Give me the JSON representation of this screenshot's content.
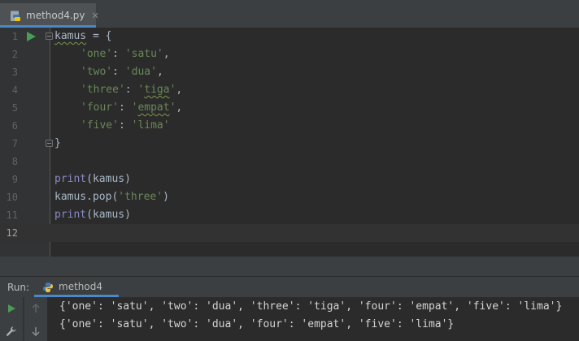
{
  "tab": {
    "filename": "method4.py",
    "close": "✕"
  },
  "editor": {
    "line_numbers": [
      "1",
      "2",
      "3",
      "4",
      "5",
      "6",
      "7",
      "8",
      "9",
      "10",
      "11",
      "12"
    ],
    "code": {
      "l1_var": "kamus",
      "l1_op": " = {",
      "l2_key": "'one'",
      "l2_sep": ": ",
      "l2_val": "'satu'",
      "l2_end": ",",
      "l3_key": "'two'",
      "l3_sep": ": ",
      "l3_val": "'dua'",
      "l3_end": ",",
      "l4_key": "'three'",
      "l4_sep": ": ",
      "l4_val_q1": "'",
      "l4_val_w": "tiga",
      "l4_val_q2": "'",
      "l4_end": ",",
      "l5_key": "'four'",
      "l5_sep": ": ",
      "l5_val_q1": "'",
      "l5_val_w": "empat",
      "l5_val_q2": "'",
      "l5_end": ",",
      "l6_key": "'five'",
      "l6_sep": ": ",
      "l6_val": "'lima'",
      "l7": "}",
      "l9_fn": "print",
      "l9_rest": "(kamus)",
      "l10_a": "kamus.pop(",
      "l10_str": "'three'",
      "l10_b": ")",
      "l11_fn": "print",
      "l11_rest": "(kamus)"
    }
  },
  "run_panel": {
    "title": "Run:",
    "tab_label": "method4",
    "output": [
      "{'one': 'satu', 'two': 'dua', 'three': 'tiga', 'four': 'empat', 'five': 'lima'}",
      "{'one': 'satu', 'two': 'dua', 'four': 'empat', 'five': 'lima'}"
    ]
  },
  "colors": {
    "background": "#2b2b2b",
    "string": "#6a8759",
    "builtin": "#8888c6",
    "run_green": "#499c54",
    "accent_blue": "#4a88c7"
  }
}
